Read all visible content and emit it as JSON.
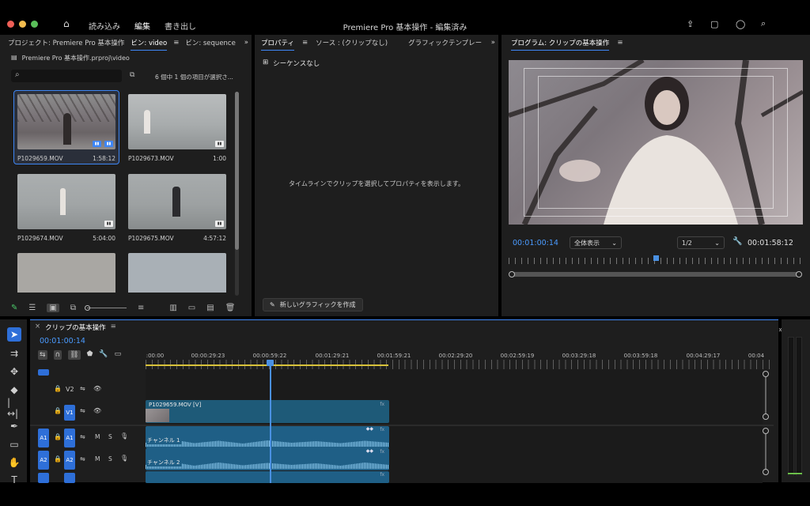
{
  "titlebar": {
    "title": "Premiere Pro 基本操作 - 編集済み",
    "workspaces": [
      "読み込み",
      "編集",
      "書き出し"
    ]
  },
  "project_panel": {
    "tabs": [
      "プロジェクト: Premiere Pro 基本操作",
      "ビン: video",
      "ビン: sequence"
    ],
    "path": "Premiere Pro 基本操作.prproj\\video",
    "search_placeholder": "",
    "item_count": "6 個中 1 個の項目が選択さ...",
    "clips": [
      {
        "name": "P1029659.MOV",
        "duration": "1:58:12"
      },
      {
        "name": "P1029673.MOV",
        "duration": "1:00"
      },
      {
        "name": "P1029674.MOV",
        "duration": "5:04:00"
      },
      {
        "name": "P1029675.MOV",
        "duration": "4:57:12"
      }
    ]
  },
  "properties_panel": {
    "tabs": [
      "プロパティ",
      "ソース : (クリップなし)",
      "グラフィックテンプレー"
    ],
    "no_sequence": "シーケンスなし",
    "hint": "タイムラインでクリップを選択してプロパティを表示します。",
    "new_graphic_button": "新しいグラフィックを作成"
  },
  "program_monitor": {
    "title": "プログラム: クリップの基本操作",
    "current_time": "00:01:00:14",
    "zoom": "全体表示",
    "resolution": "1/2",
    "duration": "00:01:58:12"
  },
  "timeline": {
    "title": "クリップの基本操作",
    "current_time": "00:01:00:14",
    "ruler": [
      ":00:00",
      "00:00:29:23",
      "00:00:59:22",
      "00:01:29:21",
      "00:01:59:21",
      "00:02:29:20",
      "00:02:59:19",
      "00:03:29:18",
      "00:03:59:18",
      "00:04:29:17",
      "00:04"
    ],
    "tracks": {
      "v2": "V2",
      "v1": "V1",
      "a1": "A1",
      "a2": "A2",
      "m": "M",
      "s": "S"
    },
    "video_clip": "P1029659.MOV [V]",
    "audio_clip_1": "チャンネル 1",
    "audio_clip_2": "チャンネル 2",
    "fx": "fx"
  },
  "colors": {
    "accent": "#3e86f5",
    "clip_video": "#1e5a78",
    "clip_audio": "#1f5f86",
    "playhead": "#4a90e2"
  }
}
